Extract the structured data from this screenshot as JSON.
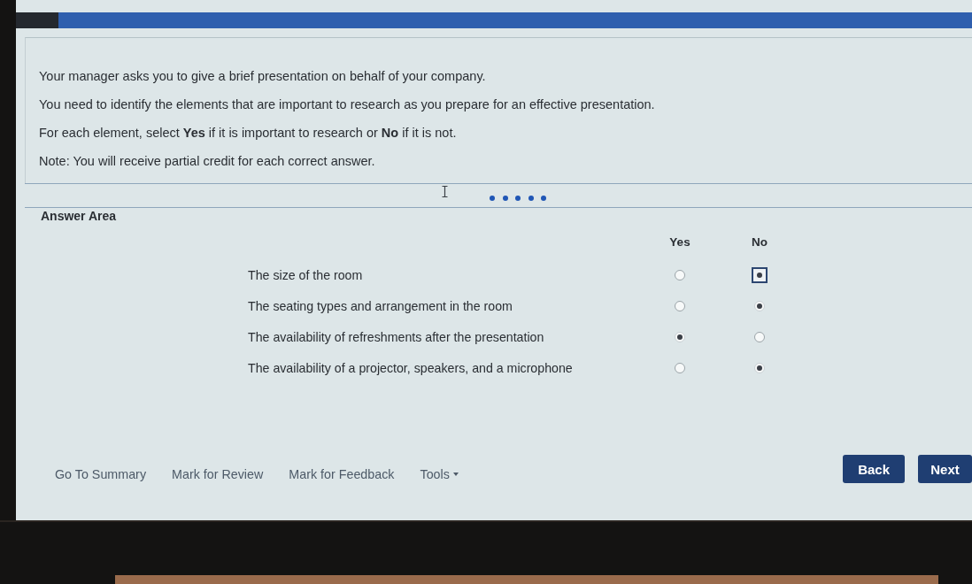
{
  "instructions": [
    "Your manager asks you to give a brief presentation on behalf of your company.",
    "You need to identify the elements that are important to research as you prepare for an effective presentation.",
    "For each element, select **Yes** if it is important to research or **No** if it is not.",
    "Note: You will receive partial credit for each correct answer."
  ],
  "answer_area": {
    "title": "Answer Area",
    "columns": [
      "Yes",
      "No"
    ],
    "rows": [
      {
        "statement": "The size of the room",
        "options": [
          {
            "selected": false,
            "focused": false
          },
          {
            "selected": true,
            "focused": true
          }
        ]
      },
      {
        "statement": "The seating types and arrangement in the room",
        "options": [
          {
            "selected": false,
            "focused": false
          },
          {
            "selected": true,
            "focused": false
          }
        ]
      },
      {
        "statement": "The availability of refreshments after the presentation",
        "options": [
          {
            "selected": true,
            "focused": false
          },
          {
            "selected": false,
            "focused": false
          }
        ]
      },
      {
        "statement": "The availability of a projector, speakers, and a microphone",
        "options": [
          {
            "selected": false,
            "focused": false
          },
          {
            "selected": true,
            "focused": false
          }
        ]
      }
    ]
  },
  "footer": {
    "links": [
      {
        "label": "Go To Summary",
        "kind": "link"
      },
      {
        "label": "Mark for Review",
        "kind": "link"
      },
      {
        "label": "Mark for Feedback",
        "kind": "link"
      },
      {
        "label": "Tools",
        "kind": "menu"
      }
    ],
    "buttons": [
      "Back",
      "Next"
    ]
  }
}
